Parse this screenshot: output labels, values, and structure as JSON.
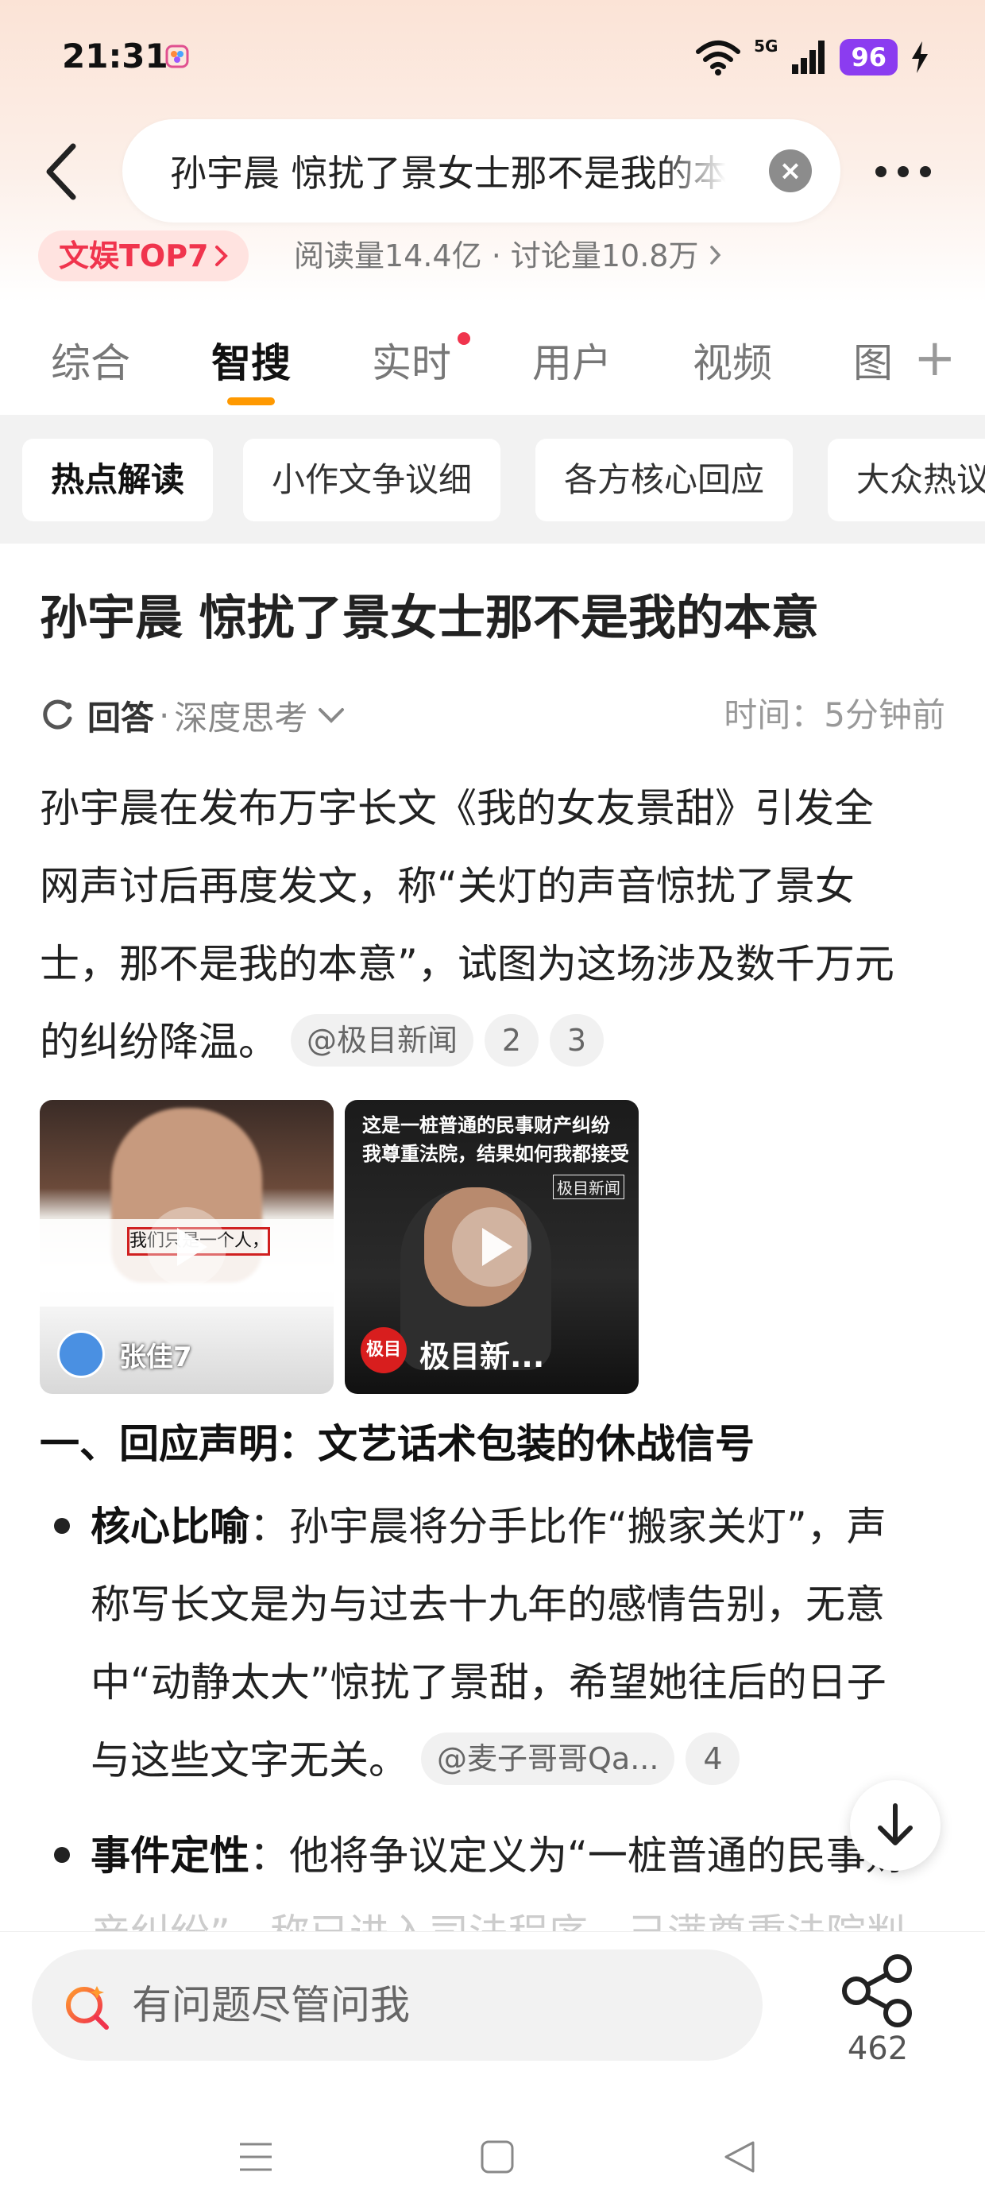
{
  "status_bar": {
    "time": "21:31",
    "network": "5G",
    "battery": "96"
  },
  "search": {
    "query": "孙宇晨 惊扰了景女士那不是我的本意"
  },
  "hot_topic": {
    "badge": "文娱TOP7",
    "stats": "阅读量14.4亿 · 讨论量10.8万"
  },
  "tabs": [
    {
      "label": "综合"
    },
    {
      "label": "智搜"
    },
    {
      "label": "实时"
    },
    {
      "label": "用户"
    },
    {
      "label": "视频"
    },
    {
      "label": "图"
    }
  ],
  "chips": [
    {
      "label": "热点解读"
    },
    {
      "label": "小作文争议细"
    },
    {
      "label": "各方核心回应"
    },
    {
      "label": "大众热议"
    }
  ],
  "article": {
    "title": "孙宇晨 惊扰了景女士那不是我的本意",
    "answer_label": "回答",
    "mode": "深度思考",
    "time": "时间：5分钟前",
    "intro_lines": [
      "孙宇晨在发布万字长文《我的女友景甜》引发全",
      "网声讨后再度发文，称“关灯的声音惊扰了景女",
      "士，那不是我的本意”，试图为这场涉及数千万元",
      "的纠纷降温。"
    ],
    "intro_source": "@极目新闻",
    "intro_refs": [
      "2",
      "3"
    ],
    "video1": {
      "overlay": "我们只是一个人，太轻了",
      "author": "张佳7"
    },
    "video2": {
      "headline1": "这是一桩普通的民事财产纠纷",
      "headline2": "我尊重法院，结果如何我都接受",
      "watermark": "极目新闻",
      "channel": "极目新..."
    },
    "section_heading": "一、回应声明：文艺话术包装的休战信号",
    "bullet1": {
      "term": "核心比喻",
      "lines": [
        "：孙宇晨将分手比作“搬家关灯”，声",
        "称写长文是为与过去十九年的感情告别，无意",
        "中“动静太大”惊扰了景甜，希望她往后的日子",
        "与这些文字无关。"
      ],
      "source": "@麦子哥哥Qa...",
      "ref": "4"
    },
    "bullet2": {
      "term": "事件定性",
      "line1": "：他将争议定义为“一桩普通的民事财",
      "line2": "产纠纷”，称已进入司法程序，己满尊重法院判"
    }
  },
  "bottom": {
    "ask_placeholder": "有问题尽管问我",
    "share_count": "462"
  },
  "colors": {
    "accent_orange": "#ff9900",
    "hot_red": "#f0344d",
    "battery_purple": "#8b3cf0"
  }
}
